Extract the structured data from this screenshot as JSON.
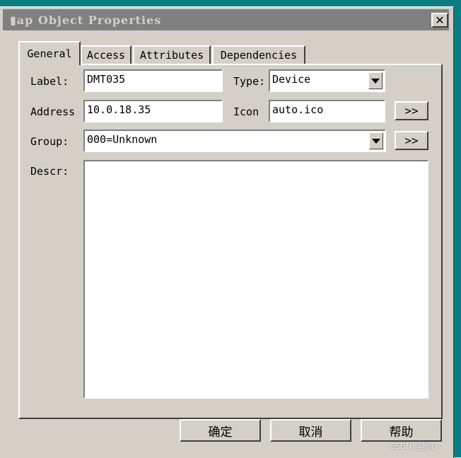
{
  "window": {
    "title": "▮ap Object Properties"
  },
  "tabs": [
    {
      "label": "General",
      "active": true
    },
    {
      "label": "Access",
      "active": false
    },
    {
      "label": "Attributes",
      "active": false
    },
    {
      "label": "Dependencies",
      "active": false
    }
  ],
  "form": {
    "label_label": "Label:",
    "label_value": "DMT035",
    "type_label": "Type:",
    "type_value": "Device",
    "address_label": "Address",
    "address_value": "10.0.18.35",
    "icon_label": "Icon",
    "icon_value": "auto.ico",
    "browse_label": ">>",
    "group_label": "Group:",
    "group_value": "000=Unknown",
    "descr_label": "Descr:",
    "descr_value": ""
  },
  "footer": {
    "ok": "确定",
    "cancel": "取消",
    "help": "帮助"
  },
  "watermark": "CSDN @牧心-",
  "icons": {
    "close": "close-icon",
    "dropdown": "chevron-down-icon"
  }
}
